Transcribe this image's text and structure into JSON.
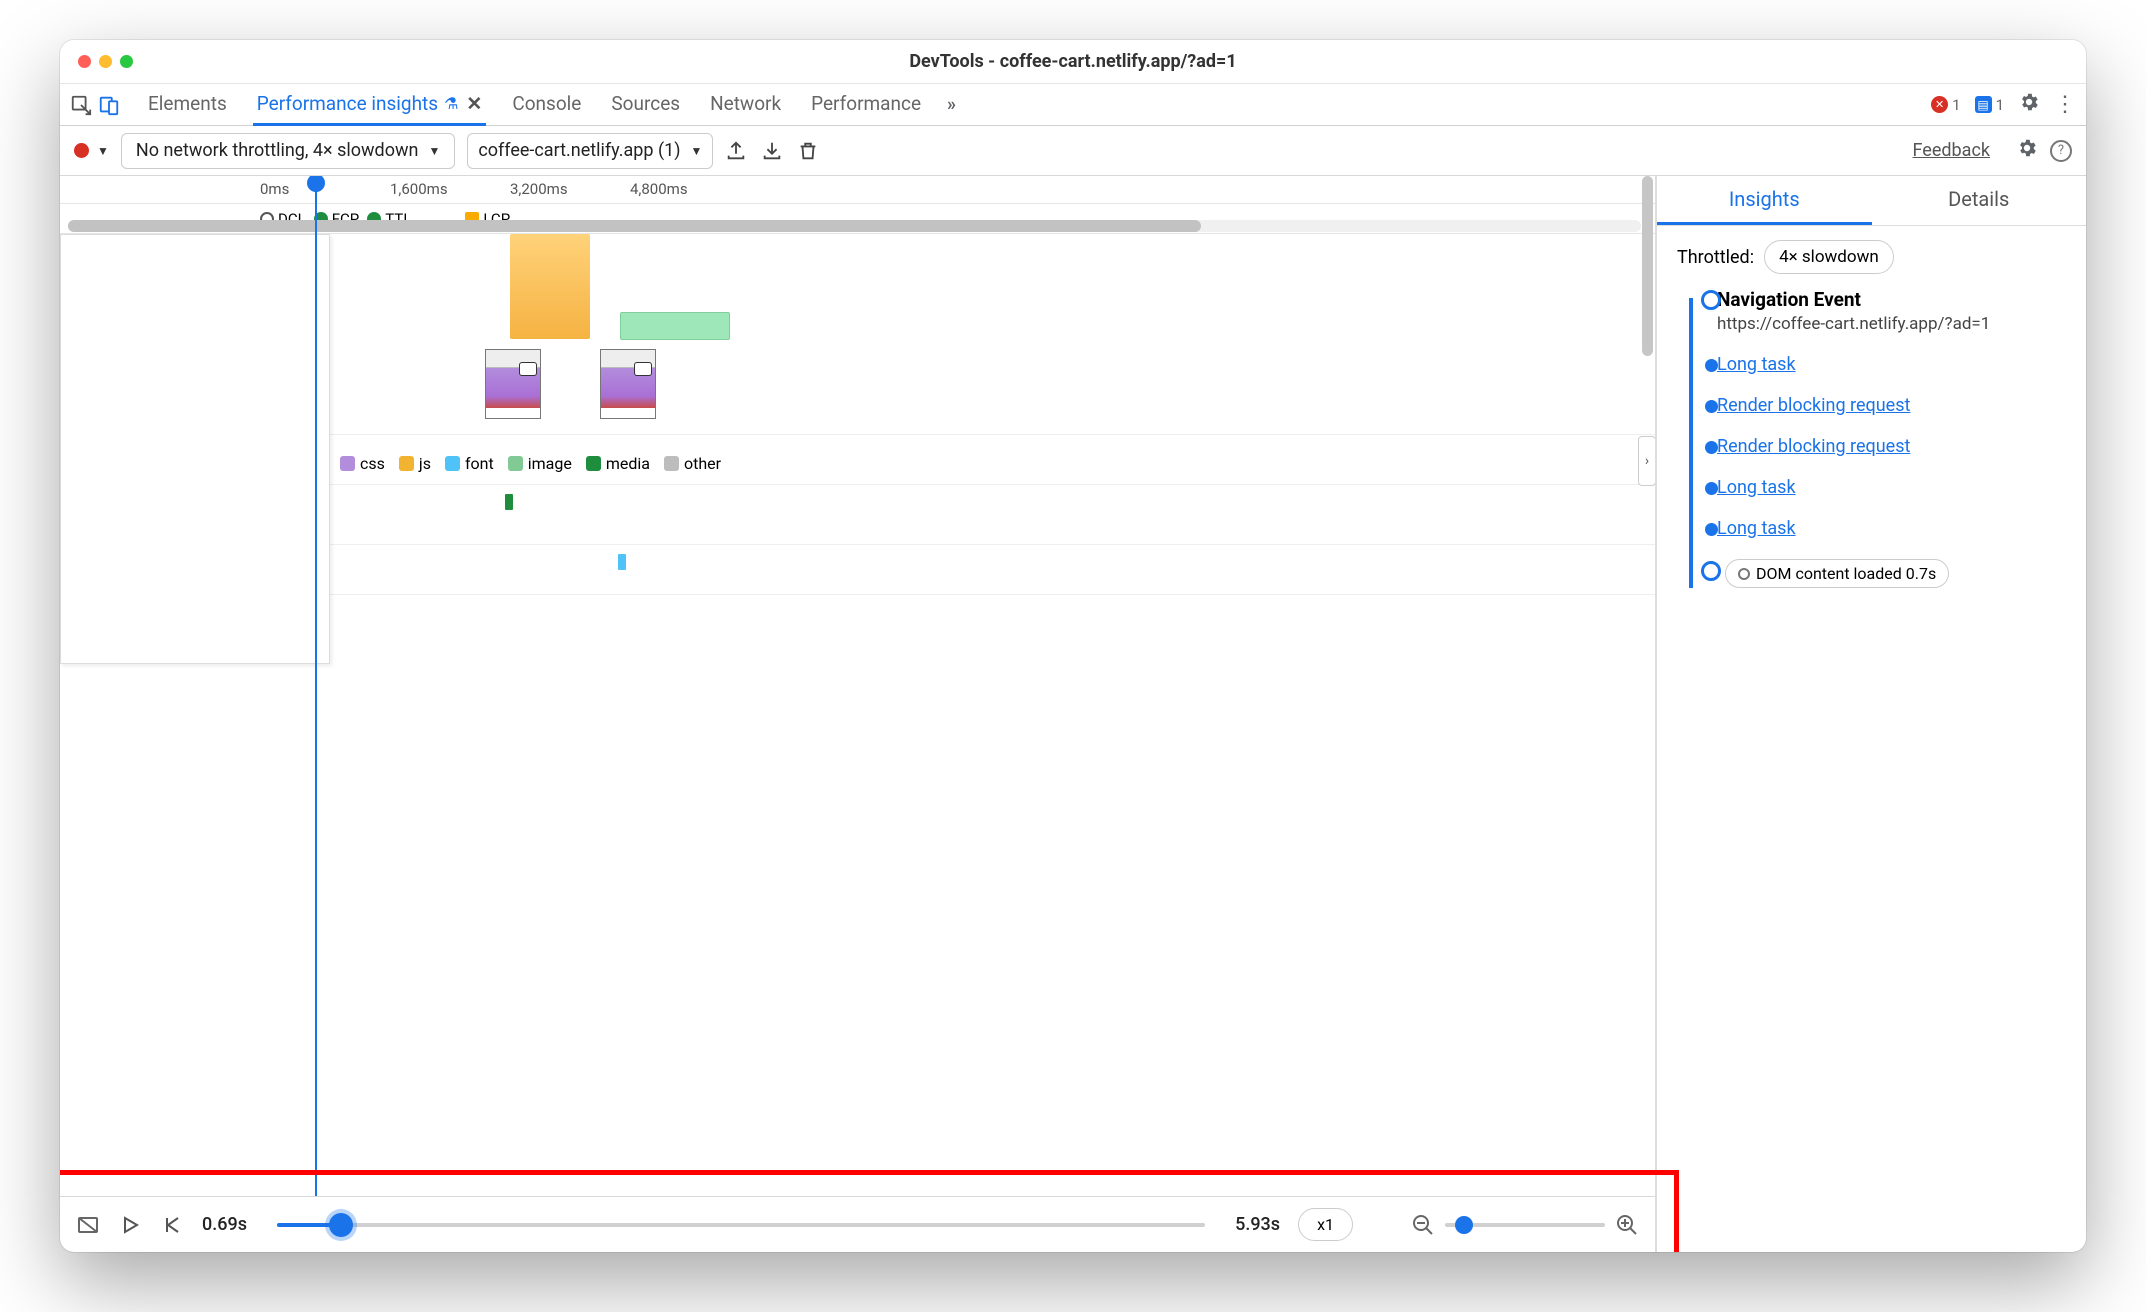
{
  "window": {
    "title": "DevTools - coffee-cart.netlify.app/?ad=1"
  },
  "tabs": {
    "elements": "Elements",
    "perf_insights": "Performance insights",
    "console": "Console",
    "sources": "Sources",
    "network": "Network",
    "performance": "Performance"
  },
  "errors_count": "1",
  "warnings_count": "1",
  "toolbar": {
    "throttling_label": "No network throttling, 4× slowdown",
    "page_selector": "coffee-cart.netlify.app (1)",
    "feedback": "Feedback"
  },
  "ruler": {
    "t0": "0ms",
    "t1": "1,600ms",
    "t2": "3,200ms",
    "t3": "4,800ms"
  },
  "markers": {
    "dcl": "DCL",
    "fcp": "FCP",
    "tti": "TTI",
    "lcp": "LCP"
  },
  "legend": {
    "css": "css",
    "js": "js",
    "font": "font",
    "image": "image",
    "media": "media",
    "other": "other"
  },
  "playback": {
    "start": "0.69s",
    "end": "5.93s",
    "speed": "x1"
  },
  "insights": {
    "tab_insights": "Insights",
    "tab_details": "Details",
    "throttled_label": "Throttled:",
    "throttled_value": "4× slowdown",
    "nav_title": "Navigation Event",
    "nav_url": "https://coffee-cart.netlify.app/?ad=1",
    "items": {
      "i1": "Long task",
      "i2": "Render blocking request",
      "i3": "Render blocking request",
      "i4": "Long task",
      "i5": "Long task"
    },
    "dcl_pill": "DOM content loaded 0.7s"
  }
}
